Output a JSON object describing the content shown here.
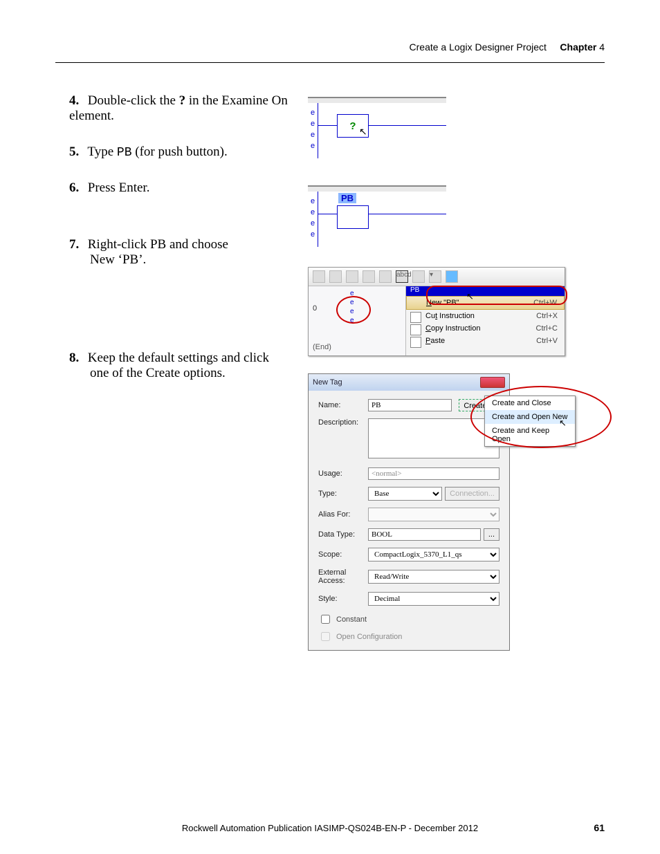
{
  "header": {
    "breadcrumb": "Create a Logix Designer Project",
    "chapter_label": "Chapter",
    "chapter_num": "4"
  },
  "steps": {
    "s4": {
      "num": "4.",
      "text_a": "Double-click the ",
      "bold": "?",
      "text_b": " in the Examine On element."
    },
    "s5": {
      "num": "5.",
      "text_a": "Type ",
      "mono": "PB",
      "text_b": " (for push button)."
    },
    "s6": {
      "num": "6.",
      "text": "Press Enter."
    },
    "s7": {
      "num": "7.",
      "text": "Right-click PB and choose New ‘PB’."
    },
    "s8": {
      "num": "8.",
      "text": "Keep the default settings and click one of the Create options."
    }
  },
  "fig1": {
    "symbol": "?",
    "e": "e"
  },
  "fig2": {
    "label": "PB",
    "e": "e"
  },
  "fig3": {
    "marker": "PB",
    "zero": "0",
    "end": "(End)",
    "menu": {
      "new": {
        "label": "New \"PB\"",
        "shortcut": "Ctrl+W"
      },
      "cut": {
        "label": "Cut Instruction",
        "shortcut": "Ctrl+X"
      },
      "copy": {
        "label": "Copy Instruction",
        "shortcut": "Ctrl+C"
      },
      "paste": {
        "label": "Paste",
        "shortcut": "Ctrl+V"
      }
    }
  },
  "fig4": {
    "title": "New Tag",
    "create_btn": "Create",
    "labels": {
      "name": "Name:",
      "description": "Description:",
      "usage": "Usage:",
      "type": "Type:",
      "alias": "Alias For:",
      "datatype": "Data Type:",
      "scope": "Scope:",
      "extaccess": "External Access:",
      "style": "Style:",
      "constant": "Constant",
      "openconf": "Open Configuration"
    },
    "values": {
      "name": "PB",
      "usage": "<normal>",
      "type": "Base",
      "connection": "Connection...",
      "datatype": "BOOL",
      "scope": "CompactLogix_5370_L1_qs",
      "extaccess": "Read/Write",
      "style": "Decimal"
    },
    "dropdown": {
      "opt1": "Create and Close",
      "opt2": "Create and Open New",
      "opt3": "Create and Keep Open"
    }
  },
  "footer": {
    "pub": "Rockwell Automation Publication IASIMP-QS024B-EN-P - December 2012",
    "page": "61"
  }
}
